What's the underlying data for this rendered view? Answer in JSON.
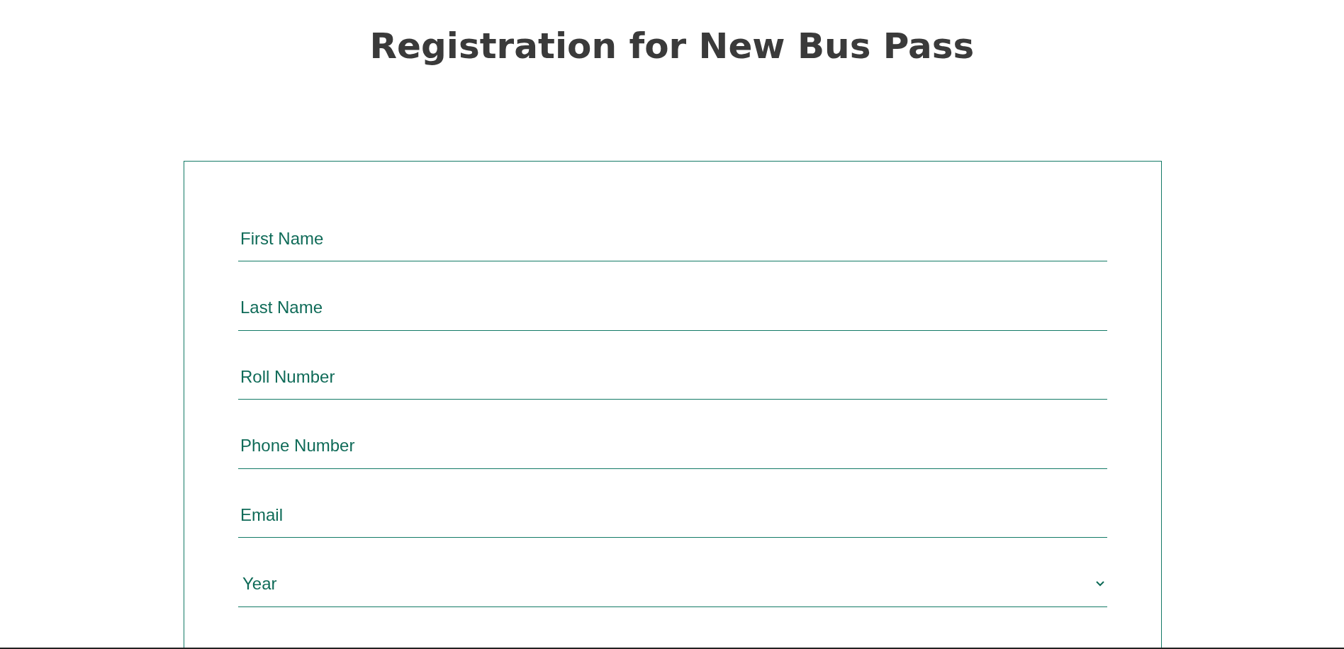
{
  "page": {
    "title": "Registration for New Bus Pass"
  },
  "form": {
    "fields": [
      {
        "kind": "text",
        "placeholder": "First Name"
      },
      {
        "kind": "text",
        "placeholder": "Last Name"
      },
      {
        "kind": "text",
        "placeholder": "Roll Number"
      },
      {
        "kind": "text",
        "placeholder": "Phone Number"
      },
      {
        "kind": "text",
        "placeholder": "Email"
      },
      {
        "kind": "select",
        "placeholder": "Year"
      }
    ]
  }
}
